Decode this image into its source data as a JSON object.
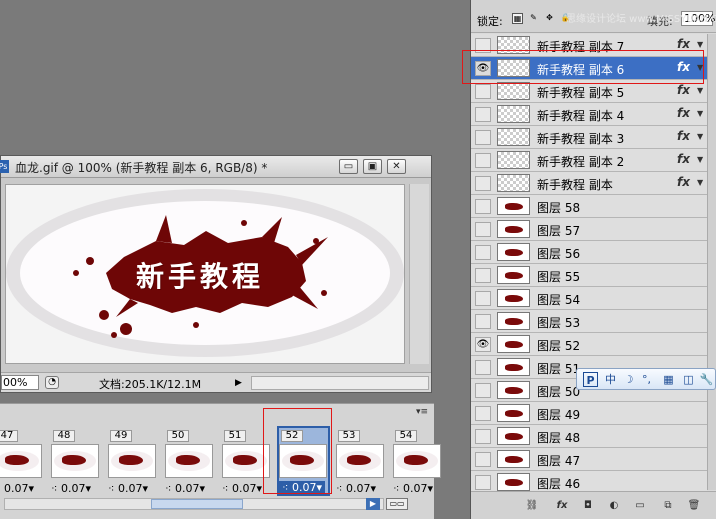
{
  "document": {
    "ps_icon": "Ps",
    "title": "血龙.gif @ 100% (新手教程 副本 6, RGB/8) *",
    "canvas_text": "新手教程",
    "zoom": "00%",
    "doc_size": "文档:205.1K/12.1M",
    "buttons": {
      "minimize": "▭",
      "restore": "▣",
      "close": "✕"
    }
  },
  "animation": {
    "frames": [
      {
        "num": "47",
        "delay": "0.07"
      },
      {
        "num": "48",
        "delay": "0.07"
      },
      {
        "num": "49",
        "delay": "0.07"
      },
      {
        "num": "50",
        "delay": "0.07"
      },
      {
        "num": "51",
        "delay": "0.07"
      },
      {
        "num": "52",
        "delay": "0.07",
        "selected": true
      },
      {
        "num": "53",
        "delay": "0.07"
      },
      {
        "num": "54",
        "delay": "0.07"
      }
    ]
  },
  "layers_panel": {
    "lock_label": "锁定:",
    "fill_label": "填充:",
    "fill_value": "100%",
    "watermark": "思缘设计论坛 www.MISSYUAN.COM",
    "layers": [
      {
        "name": "新手教程 副本 7",
        "fx": true,
        "visible": false,
        "thumb": "transparent"
      },
      {
        "name": "新手教程 副本 6",
        "fx": true,
        "visible": true,
        "selected": true,
        "thumb": "transparent"
      },
      {
        "name": "新手教程 副本 5",
        "fx": true,
        "visible": false,
        "thumb": "transparent"
      },
      {
        "name": "新手教程 副本 4",
        "fx": true,
        "visible": false,
        "thumb": "transparent"
      },
      {
        "name": "新手教程 副本 3",
        "fx": true,
        "visible": false,
        "thumb": "transparent"
      },
      {
        "name": "新手教程 副本 2",
        "fx": true,
        "visible": false,
        "thumb": "transparent"
      },
      {
        "name": "新手教程 副本",
        "fx": true,
        "visible": false,
        "thumb": "transparent"
      },
      {
        "name": "图层 58",
        "visible": false,
        "thumb": "image"
      },
      {
        "name": "图层 57",
        "visible": false,
        "thumb": "image"
      },
      {
        "name": "图层 56",
        "visible": false,
        "thumb": "image"
      },
      {
        "name": "图层 55",
        "visible": false,
        "thumb": "image"
      },
      {
        "name": "图层 54",
        "visible": false,
        "thumb": "image"
      },
      {
        "name": "图层 53",
        "visible": false,
        "thumb": "image"
      },
      {
        "name": "图层 52",
        "visible": true,
        "thumb": "image"
      },
      {
        "name": "图层 51",
        "visible": false,
        "thumb": "image"
      },
      {
        "name": "图层 50",
        "visible": false,
        "thumb": "image"
      },
      {
        "name": "图层 49",
        "visible": false,
        "thumb": "image"
      },
      {
        "name": "图层 48",
        "visible": false,
        "thumb": "image"
      },
      {
        "name": "图层 47",
        "visible": false,
        "thumb": "image"
      },
      {
        "name": "图层 46",
        "visible": false,
        "thumb": "image"
      }
    ]
  },
  "ime_bar": {
    "items": [
      "P",
      "中",
      "☽",
      "°,",
      "▦",
      "◫",
      "🔧"
    ]
  },
  "colors": {
    "selection_blue": "#3c6fc4",
    "highlight_red": "#e01818",
    "blood_red": "#6e0606"
  }
}
